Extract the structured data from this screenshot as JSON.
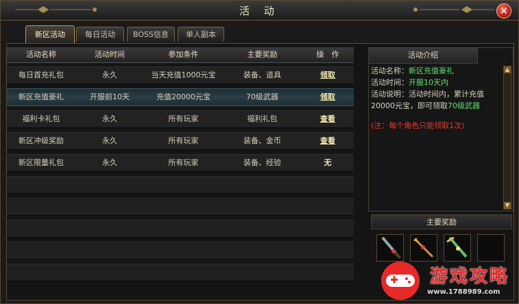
{
  "window": {
    "title": "活 动",
    "close_label": "×"
  },
  "tabs": [
    {
      "label": "新区活动",
      "active": true
    },
    {
      "label": "每日活动",
      "active": false
    },
    {
      "label": "BOSS信息",
      "active": false
    },
    {
      "label": "单人副本",
      "active": false
    }
  ],
  "table": {
    "headers": [
      "活动名称",
      "活动时间",
      "参加条件",
      "主要奖励",
      "操　作"
    ],
    "rows": [
      {
        "name": "每日首充礼包",
        "time": "永久",
        "condition": "当天充值1000元宝",
        "reward": "装备、道具",
        "action": "领取",
        "selected": false
      },
      {
        "name": "新区充值豪礼",
        "time": "开服前10天",
        "condition": "充值20000元宝",
        "reward": "70级武器",
        "action": "领取",
        "selected": true
      },
      {
        "name": "福利卡礼包",
        "time": "永久",
        "condition": "所有玩家",
        "reward": "福利礼包",
        "action": "查看",
        "selected": false
      },
      {
        "name": "新区冲级奖励",
        "time": "永久",
        "condition": "所有玩家",
        "reward": "装备、金币",
        "action": "查看",
        "selected": false
      },
      {
        "name": "新区限量礼包",
        "time": "永久",
        "condition": "所有玩家",
        "reward": "装备、经验",
        "action": "无",
        "selected": false
      }
    ]
  },
  "intro": {
    "header": "活动介绍",
    "name_label": "活动名称：",
    "name_value": "新区充值豪礼",
    "time_label": "活动时间：",
    "time_value": "开服10天内",
    "desc_label": "活动说明：活动时间内，累计充值20000元宝，即可领取",
    "desc_value": "70级武器",
    "note": "(注：每个角色只能领取1次)"
  },
  "rewards": {
    "header": "主要奖励",
    "items": [
      "weapon-icon",
      "weapon-icon",
      "weapon-icon",
      "empty"
    ]
  },
  "watermark": {
    "text": "游戏攻略",
    "url": "www.1788989.com"
  },
  "colors": {
    "highlight": "#5fe06a",
    "note": "#e23b2e",
    "accent_gold": "#b89b62"
  }
}
